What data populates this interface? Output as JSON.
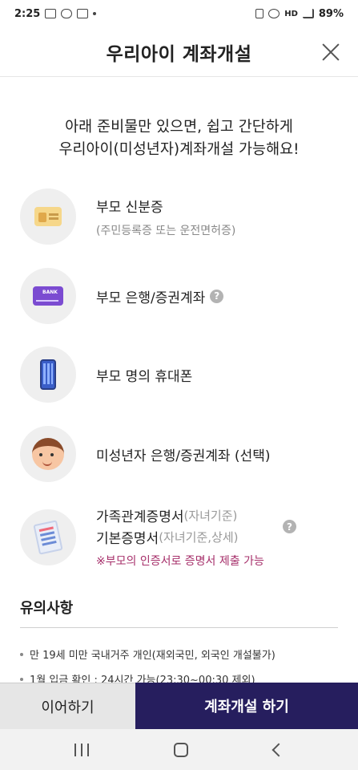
{
  "status_bar": {
    "time": "2:25",
    "left_icons": [
      "gallery-icon",
      "talk-icon",
      "talk-icon",
      "vpn-icon"
    ],
    "network": "HD",
    "battery": "89%"
  },
  "header": {
    "title": "우리아이 계좌개설"
  },
  "intro": {
    "line1": "아래 준비물만 있으면, 쉽고 간단하게",
    "line2": "우리아이(미성년자)계좌개설 가능해요!"
  },
  "requirements": [
    {
      "title": "부모 신분증",
      "sub": "(주민등록증 또는 운전면허증)",
      "icon": "id-card-icon"
    },
    {
      "title": "부모 은행/증권계좌",
      "help": "?",
      "icon": "bank-card-icon"
    },
    {
      "title": "부모 명의 휴대폰",
      "icon": "phone-icon"
    },
    {
      "title": "미성년자 은행/증권계좌 (선택)",
      "icon": "child-face-icon"
    },
    {
      "title1": "가족관계증명서",
      "title1_sub": "(자녀기준)",
      "title2": "기본증명서",
      "title2_sub": "(자녀기준,상세)",
      "help": "?",
      "note": "※부모의 인증서로 증명서 제출 가능",
      "icon": "document-icon"
    }
  ],
  "notice": {
    "title": "유의사항",
    "items": [
      "만 19세 미만 국내거주 개인(재외국민, 외국인 개설불가)",
      "1월 입금 확인 : 24시간 가능(23:30~00:30 제외)"
    ]
  },
  "buttons": {
    "continue": "이어하기",
    "open_account": "계좌개설 하기"
  },
  "colors": {
    "primary": "#261e5e",
    "note": "#a62f6a"
  }
}
